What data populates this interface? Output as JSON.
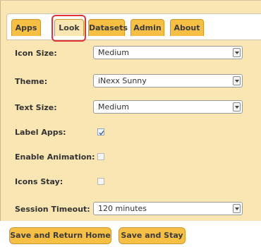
{
  "tabs": [
    {
      "label": "Apps",
      "active": false
    },
    {
      "label": "Look",
      "active": true
    },
    {
      "label": "Datasets",
      "active": false
    },
    {
      "label": "Admin",
      "active": false
    },
    {
      "label": "About",
      "active": false
    }
  ],
  "settings": {
    "icon_size": {
      "label": "Icon Size:",
      "value": "Medium"
    },
    "theme": {
      "label": "Theme:",
      "value": "iNexx Sunny"
    },
    "text_size": {
      "label": "Text Size:",
      "value": "Medium"
    },
    "label_apps": {
      "label": "Label Apps:",
      "checked": true
    },
    "enable_animation": {
      "label": "Enable Animation:",
      "checked": false
    },
    "icons_stay": {
      "label": "Icons Stay:",
      "checked": false
    },
    "session_timeout": {
      "label": "Session Timeout:",
      "value": "120 minutes"
    }
  },
  "buttons": {
    "save_return": "Save and Return Home",
    "save_stay": "Save and Stay"
  },
  "colors": {
    "panel_bg": "#f9e6b3",
    "tab_bg": "#f7c045",
    "highlight": "#e03434"
  }
}
